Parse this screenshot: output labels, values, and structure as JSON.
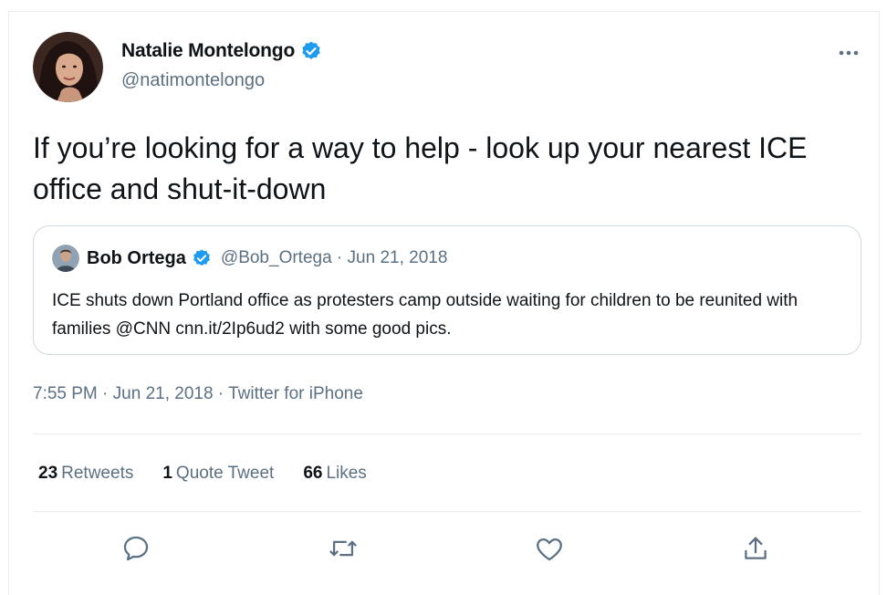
{
  "author": {
    "display_name": "Natalie Montelongo",
    "handle": "@natimontelongo",
    "verified": true
  },
  "tweet": {
    "text": "If you’re looking for a way to help - look up your nearest ICE office and shut-it-down"
  },
  "quoted_tweet": {
    "display_name": "Bob Ortega",
    "handle": "@Bob_Ortega",
    "date": "Jun 21, 2018",
    "verified": true,
    "text": "ICE shuts down Portland office as protesters camp outside waiting for children to be reunited with families @CNN cnn.it/2Ip6ud2 with some good pics."
  },
  "meta": {
    "time": "7:55 PM",
    "date": "Jun 21, 2018",
    "source": "Twitter for iPhone"
  },
  "stats": {
    "retweets_count": "23",
    "retweets_label": "Retweets",
    "quotes_count": "1",
    "quotes_label": "Quote Tweet",
    "likes_count": "66",
    "likes_label": "Likes"
  },
  "colors": {
    "accent": "#1d9bf0",
    "secondary_text": "#5b7083",
    "border": "#cfd9de"
  },
  "icons": {
    "more": "more-horizontal-icon",
    "verified": "verified-badge-icon",
    "reply": "reply-icon",
    "retweet": "retweet-icon",
    "like": "heart-icon",
    "share": "share-icon"
  }
}
